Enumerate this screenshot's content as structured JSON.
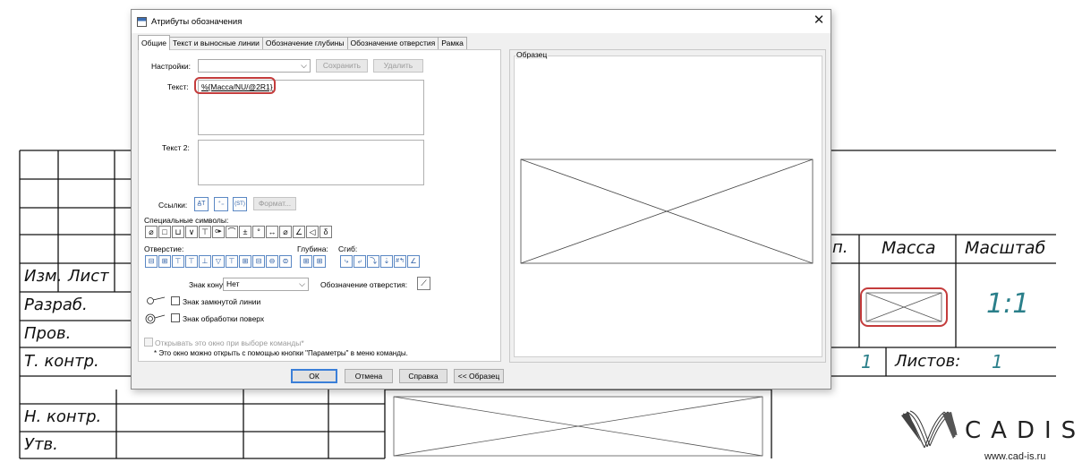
{
  "dialog": {
    "title": "Атрибуты обозначения",
    "close_label": "✕",
    "tabs": [
      {
        "label": "Общие",
        "active": true
      },
      {
        "label": "Текст и выносные линии",
        "active": false
      },
      {
        "label": "Обозначение глубины",
        "active": false
      },
      {
        "label": "Обозначение отверстия",
        "active": false
      },
      {
        "label": "Рамка",
        "active": false
      }
    ],
    "settings": {
      "label": "Настройки:",
      "value": "",
      "save_label": "Сохранить",
      "delete_label": "Удалить"
    },
    "text": {
      "label": "Текст:",
      "value": "%{Масса/NU/@2R1}"
    },
    "text2": {
      "label": "Текст 2:",
      "value": ""
    },
    "links": {
      "label": "Ссылки:",
      "format_label": "Формат..."
    },
    "special_symbols": {
      "label": "Специальные символы:",
      "symbols": [
        "⌀",
        "□",
        "⊔",
        "∨",
        "⊤",
        "o▸",
        "⌒",
        "±",
        "°",
        "↔",
        "⌀",
        "∠",
        "◁",
        "δ"
      ]
    },
    "hole": {
      "label": "Отверстие:"
    },
    "depth": {
      "label": "Глубина:"
    },
    "bend": {
      "label": "Сгиб:"
    },
    "cone_sign": {
      "label": "Знак конуса:",
      "value": "Нет"
    },
    "hole_designation": {
      "label": "Обозначение отверстия:"
    },
    "closed_line_sign": {
      "label": "Знак замкнутой линии",
      "checked": false
    },
    "over_processing_sign": {
      "label": "Знак обработки поверх",
      "checked": false
    },
    "open_on_command": {
      "label": "Открывать это окно при выборе команды*",
      "checked": false
    },
    "note": "* Это окно можно открыть с помощью кнопки \"Параметры\" в меню команды.",
    "preview": {
      "label": "Образец"
    },
    "buttons": {
      "ok": "ОК",
      "cancel": "Отмена",
      "help": "Справка",
      "sample": "<< Образец"
    }
  },
  "title_block": {
    "left_rows": [
      "Изм.",
      "Лист",
      "Разраб.",
      "Пров.",
      "Т. контр.",
      "Н. контр.",
      "Утв."
    ],
    "mass_header": "Масса",
    "scale_header": "Масштаб",
    "lit_partial": "п.",
    "scale_value": "1:1",
    "sheet_value": "1",
    "sheets_label": "Листов:",
    "sheets_value": "1"
  },
  "logo": {
    "name": "CADIS",
    "url": "www.cad-is.ru"
  },
  "colors": {
    "highlight_red": "#c43c3c",
    "teal_value": "#2a7f8a"
  }
}
